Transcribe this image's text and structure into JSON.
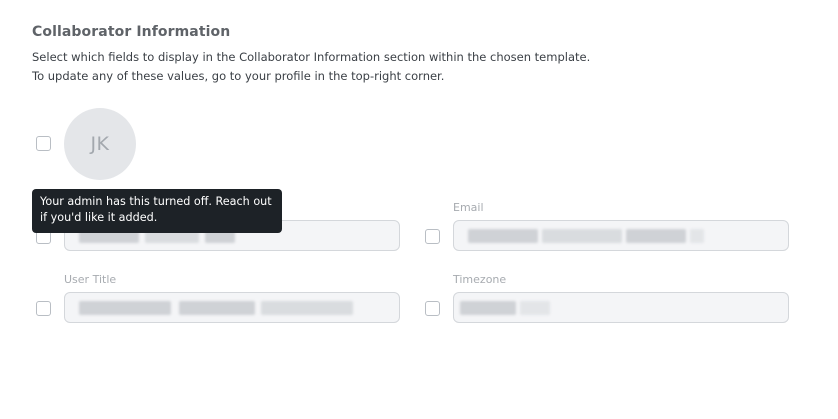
{
  "section": {
    "title": "Collaborator Information",
    "description_line1": "Select which fields to display in the Collaborator Information section within the chosen template.",
    "description_line2": "To update any of these values, go to your profile in the top-right corner."
  },
  "avatar": {
    "initials": "JK"
  },
  "fields": {
    "email": {
      "label": "Email",
      "checked": false
    },
    "user_title": {
      "label": "User Title",
      "checked": false
    },
    "timezone": {
      "label": "Timezone",
      "checked": false
    },
    "name": {
      "checked": false
    }
  },
  "tooltip": {
    "line1": "Your admin has this turned off. Reach out",
    "line2": "if you'd like it added."
  }
}
